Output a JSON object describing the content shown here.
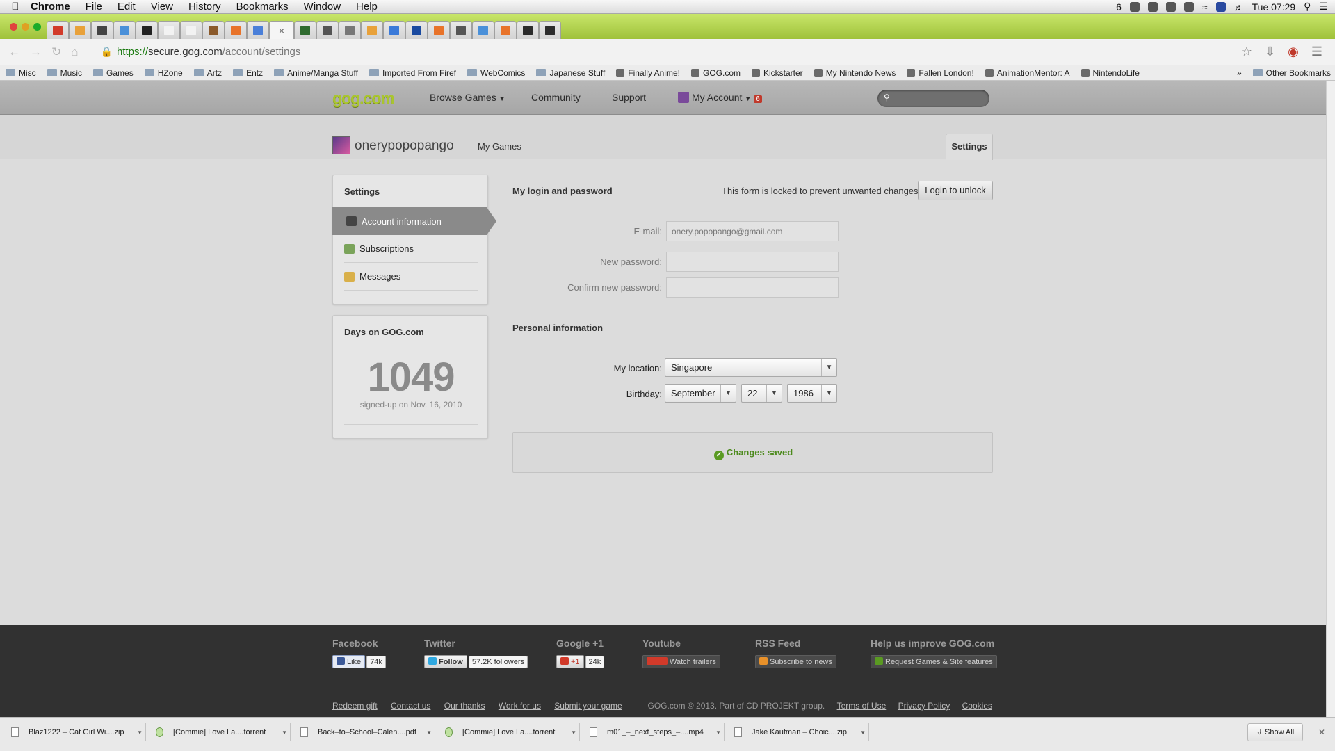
{
  "os": {
    "app_name": "Chrome",
    "menus": [
      "File",
      "Edit",
      "View",
      "History",
      "Bookmarks",
      "Window",
      "Help"
    ],
    "status_count": "6",
    "clock": "Tue 07:29"
  },
  "browser": {
    "tab_icons": [
      "#d23a2a",
      "#e8a13a",
      "#444444",
      "#4a90d9",
      "#222222",
      "#f2f2f2",
      "#f2f2f2",
      "#8b5a2b",
      "#e8732a",
      "#4a7fd9",
      "#2f6b2f",
      "#555555",
      "#777777",
      "#e8a13a",
      "#3a7ad9",
      "#1a4aa0",
      "#e8732a",
      "#555555",
      "#4a90d9",
      "#e8732a",
      "#2b2b2b",
      "#2b2b2b"
    ],
    "active_tab_glyph": "×",
    "url_scheme": "https://",
    "url_host": "secure.gog.com",
    "url_path": "/account/settings",
    "bookmarks": [
      "Misc",
      "Music",
      "Games",
      "HZone",
      "Artz",
      "Entz",
      "Anime/Manga Stuff",
      "Imported From Firef",
      "WebComics",
      "Japanese Stuff",
      "Finally Anime!",
      "GOG.com",
      "Kickstarter",
      "My Nintendo News",
      "Fallen London!",
      "AnimationMentor: A",
      "NintendoLife"
    ],
    "other_bookmarks": "Other Bookmarks",
    "more_bookmarks": "»"
  },
  "gog": {
    "logo": "gog.com",
    "nav": {
      "browse": "Browse Games",
      "community": "Community",
      "support": "Support",
      "account": "My Account",
      "account_badge": "6"
    },
    "username": "onerypopopango",
    "my_games": "My Games",
    "settings_tab": "Settings",
    "sidebar": {
      "title": "Settings",
      "items": [
        {
          "label": "Account information",
          "icon": "person-icon",
          "active": true
        },
        {
          "label": "Subscriptions",
          "icon": "newsletter-icon",
          "active": false
        },
        {
          "label": "Messages",
          "icon": "envelope-icon",
          "active": false
        }
      ]
    },
    "days": {
      "title": "Days on GOG.com",
      "count": "1049",
      "signed_up": "signed-up on Nov. 16, 2010"
    },
    "login": {
      "title": "My login and password",
      "locked_text": "This form is locked to prevent unwanted changes.",
      "unlock_label": "Login to unlock",
      "email_label": "E-mail:",
      "email_value": "onery.popopango@gmail.com",
      "new_pw_label": "New password:",
      "confirm_pw_label": "Confirm new password:"
    },
    "personal": {
      "title": "Personal information",
      "location_label": "My location:",
      "location_value": "Singapore",
      "birthday_label": "Birthday:",
      "month": "September",
      "day": "22",
      "year": "1986"
    },
    "saved_text": "Changes saved",
    "footer": {
      "facebook": {
        "title": "Facebook",
        "btn": "Like",
        "count": "74k"
      },
      "twitter": {
        "title": "Twitter",
        "btn": "Follow",
        "count": "57.2K followers"
      },
      "gplus": {
        "title": "Google +1",
        "btn": "+1",
        "count": "24k"
      },
      "youtube": {
        "title": "Youtube",
        "btn": "Watch trailers"
      },
      "rss": {
        "title": "RSS Feed",
        "btn": "Subscribe to news"
      },
      "improve": {
        "title": "Help us improve GOG.com",
        "btn": "Request Games & Site features"
      },
      "links": [
        "Redeem gift",
        "Contact us",
        "Our thanks",
        "Work for us",
        "Submit your game"
      ],
      "copyright": "GOG.com © 2013. Part of CD PROJEKT group.",
      "legal": [
        "Terms of Use",
        "Privacy Policy",
        "Cookies"
      ]
    }
  },
  "downloads": {
    "items": [
      "Blaz1222 – Cat Girl Wi....zip",
      "[Commie] Love La....torrent",
      "Back–to–School–Calen....pdf",
      "[Commie] Love La....torrent",
      "m01_–_next_steps_–....mp4",
      "Jake Kaufman – Choic....zip"
    ],
    "show_all": "Show All"
  },
  "colors": {
    "gog_green": "#a9c52f",
    "saved_green": "#4c8a1c",
    "badge_red": "#c0392b",
    "tabstrip_green": "#9fc23a"
  }
}
